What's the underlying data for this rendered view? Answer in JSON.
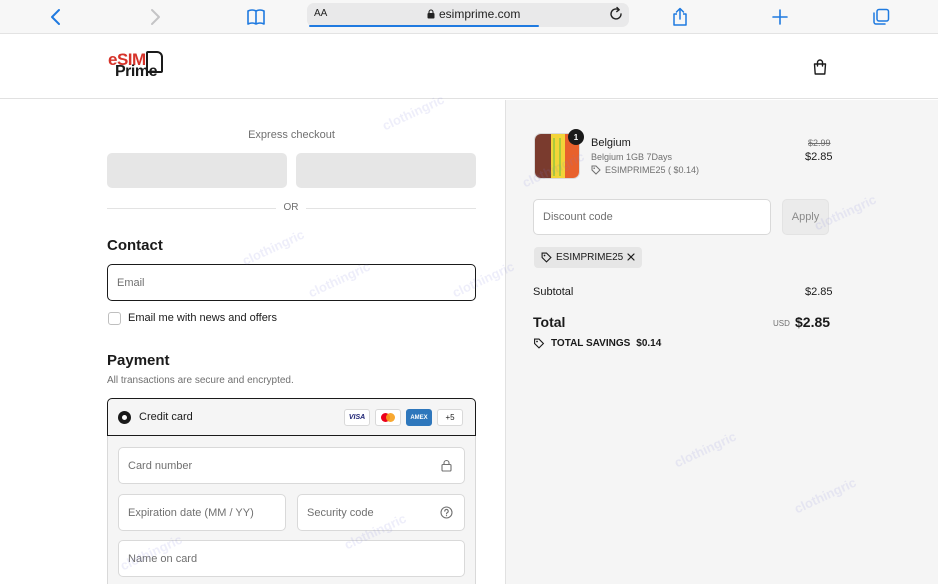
{
  "browser": {
    "url_aa": "AA",
    "url": "esimprime.com"
  },
  "header": {
    "logo_line1": "eSIM",
    "logo_line2": "Prime"
  },
  "checkout": {
    "express_label": "Express checkout",
    "or_label": "OR",
    "contact": {
      "title": "Contact",
      "email_placeholder": "Email",
      "newsletter_label": "Email me with news and offers"
    },
    "payment": {
      "title": "Payment",
      "subtitle": "All transactions are secure and encrypted.",
      "method_label": "Credit card",
      "card_brands": [
        "VISA",
        "AMEX",
        "+5"
      ],
      "card_number_placeholder": "Card number",
      "expiration_placeholder": "Expiration date (MM / YY)",
      "security_placeholder": "Security code",
      "name_placeholder": "Name on card"
    }
  },
  "summary": {
    "item": {
      "quantity": "1",
      "name": "Belgium",
      "variant": "Belgium 1GB 7Days",
      "discount_line": "ESIMPRIME25 ( $0.14)",
      "original_price": "$2.99",
      "price": "$2.85"
    },
    "discount_placeholder": "Discount code",
    "apply_label": "Apply",
    "applied_code": "ESIMPRIME25",
    "subtotal_label": "Subtotal",
    "subtotal_value": "$2.85",
    "total_label": "Total",
    "currency": "USD",
    "total_value": "$2.85",
    "savings_label": "TOTAL SAVINGS",
    "savings_value": "$0.14"
  },
  "watermark": "clothingric",
  "colors": {
    "brand_red": "#d6332a",
    "ios_blue": "#1f7ae0",
    "panel_bg": "#f5f5f5",
    "amex_blue": "#2e77bc"
  }
}
